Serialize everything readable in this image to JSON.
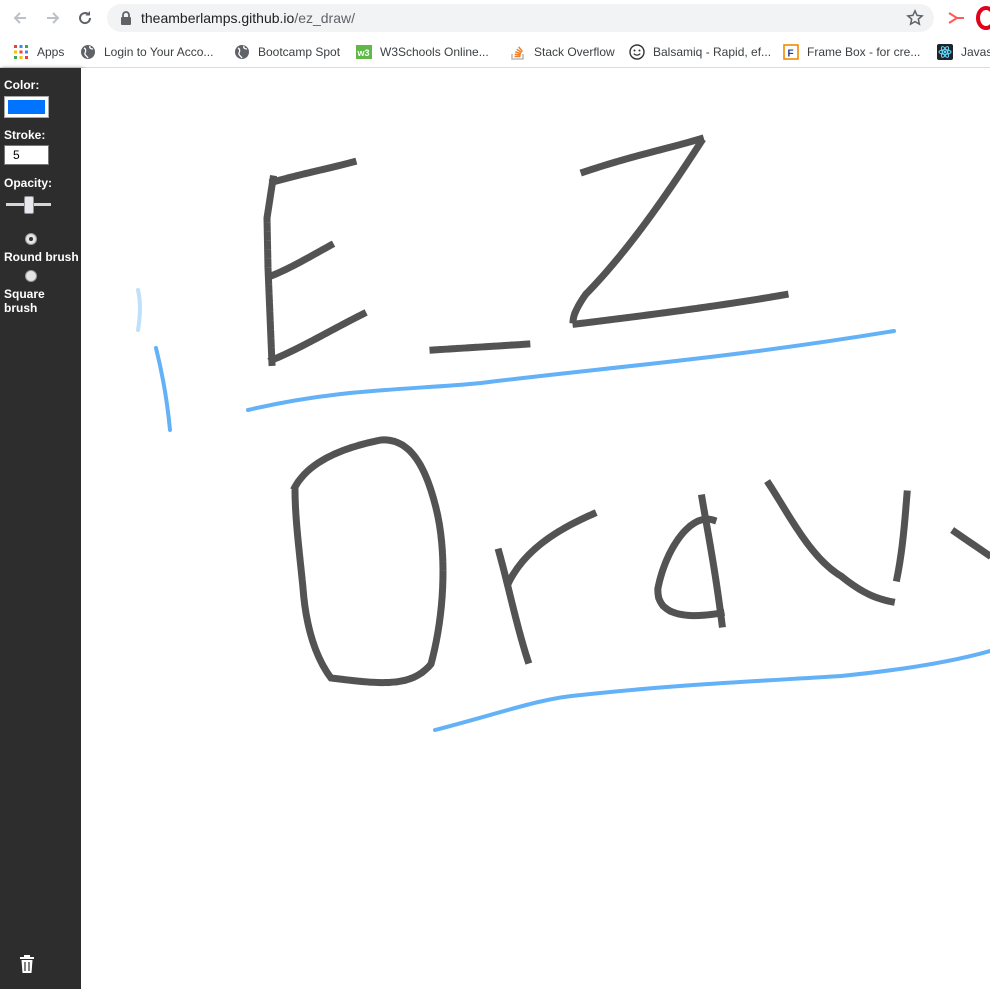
{
  "browser": {
    "url_host": "theamberlamps.github.io",
    "url_path": "/ez_draw/",
    "bookmarks": [
      {
        "label": "Apps",
        "icon": "apps-grid-icon"
      },
      {
        "label": "Login to Your Acco...",
        "icon": "globe-icon"
      },
      {
        "label": "Bootcamp Spot",
        "icon": "globe-icon"
      },
      {
        "label": "W3Schools Online...",
        "icon": "w3schools-icon"
      },
      {
        "label": "Stack Overflow",
        "icon": "stackoverflow-icon"
      },
      {
        "label": "Balsamiq - Rapid, ef...",
        "icon": "smiley-icon"
      },
      {
        "label": "Frame Box - for cre...",
        "icon": "framebox-icon"
      },
      {
        "label": "Javasc",
        "icon": "react-icon"
      }
    ]
  },
  "toolbar": {
    "color_label": "Color:",
    "color_value": "#0073ff",
    "stroke_label": "Stroke:",
    "stroke_value": "5",
    "opacity_label": "Opacity:",
    "opacity_value": 0.5,
    "brushes": [
      {
        "label": "Round brush",
        "checked": true
      },
      {
        "label": "Square brush",
        "checked": false
      }
    ],
    "clear_icon": "trash-icon"
  },
  "colors": {
    "sidebar_bg": "#2d2d2d",
    "stroke_blue": "#63b1f7",
    "stroke_black": "#1a1a1a"
  }
}
